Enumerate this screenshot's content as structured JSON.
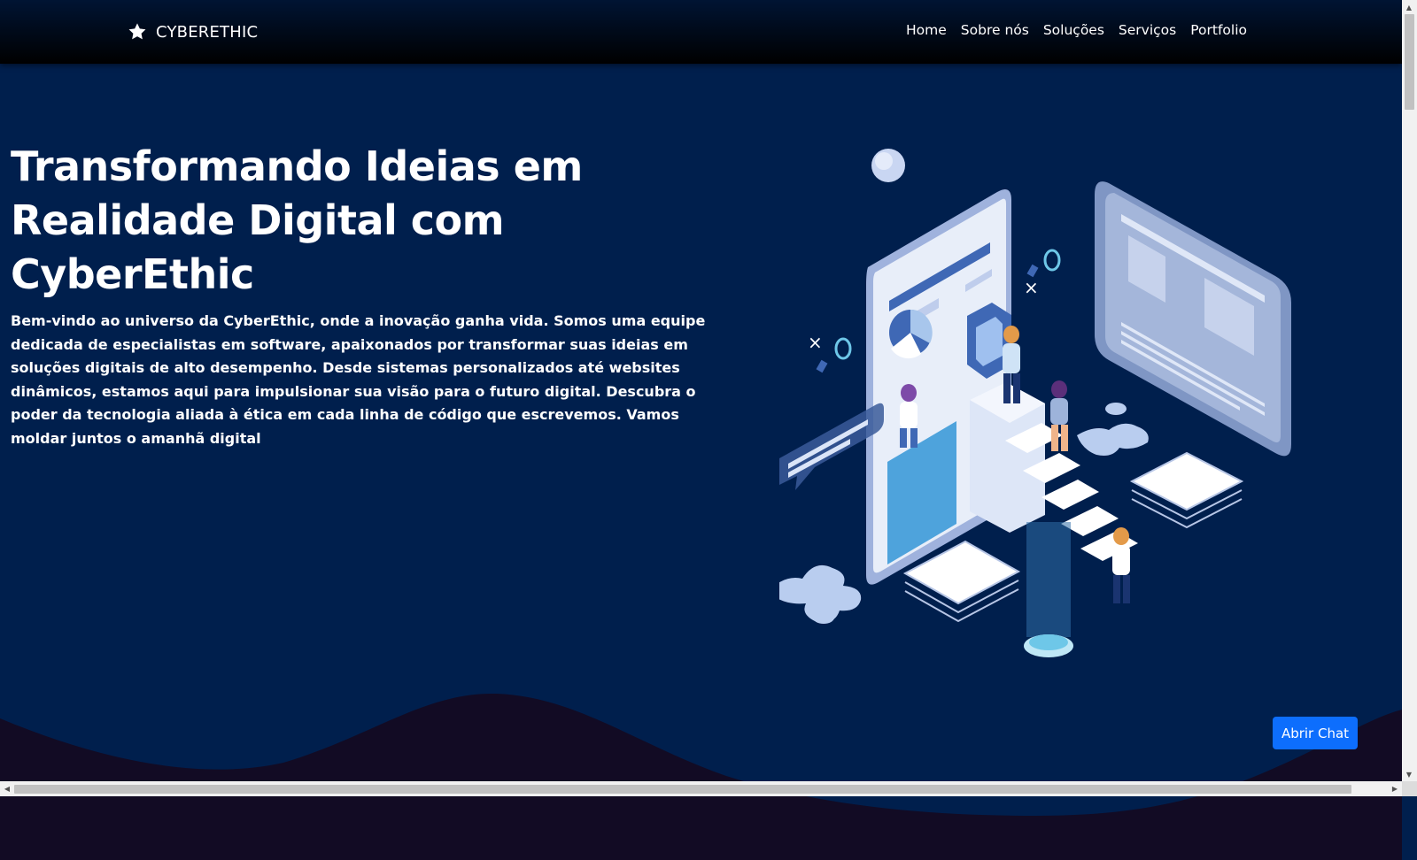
{
  "navbar": {
    "brand": "CYBERETHIC",
    "brand_icon": "star-icon",
    "links": [
      "Home",
      "Sobre nós",
      "Soluções",
      "Serviços",
      "Portfolio"
    ]
  },
  "hero": {
    "title": "Transformando Ideias em Realidade Digital com CyberEthic",
    "text": "Bem-vindo ao universo da CyberEthic, onde a inovação ganha vida. Somos uma equipe dedicada de especialistas em software, apaixonados por transformar suas ideias em soluções digitais de alto desempenho. Desde sistemas personalizados até websites dinâmicos, estamos aqui para impulsionar sua visão para o futuro digital. Descubra o poder da tecnologia aliada à ética em cada linha de código que escrevemos. Vamos moldar juntos o amanhã digital"
  },
  "chat": {
    "label": "Abrir Chat"
  },
  "colors": {
    "background": "#001f4d",
    "wave": "#120b24",
    "accent": "#0d6efd"
  }
}
